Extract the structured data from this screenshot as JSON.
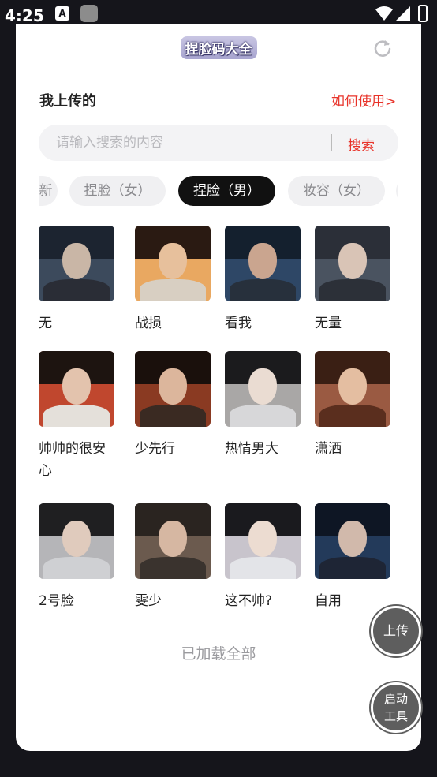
{
  "status_bar": {
    "time": "4:25",
    "a_badge": "A"
  },
  "header": {
    "title": "捏脸码大全",
    "refresh_icon": "refresh-icon"
  },
  "section": {
    "my_uploads": "我上传的",
    "how_to_use": "如何使用>"
  },
  "search": {
    "placeholder": "请输入搜索的内容",
    "button": "搜索"
  },
  "tabs": [
    {
      "label": "新",
      "active": false
    },
    {
      "label": "捏脸（女）",
      "active": false
    },
    {
      "label": "捏脸（男）",
      "active": true
    },
    {
      "label": "妆容（女）",
      "active": false
    }
  ],
  "items": [
    {
      "name": "无"
    },
    {
      "name": "战损"
    },
    {
      "name": "看我"
    },
    {
      "name": "无量"
    },
    {
      "name": "帅帅的很安心"
    },
    {
      "name": "少先行"
    },
    {
      "name": "热情男大"
    },
    {
      "name": "潇洒"
    },
    {
      "name": "2号脸"
    },
    {
      "name": "雯少"
    },
    {
      "name": "这不帅?"
    },
    {
      "name": "自用"
    }
  ],
  "footer": {
    "loaded_all": "已加载全部"
  },
  "fabs": {
    "upload": "上传",
    "launch_tool": "启动工具"
  },
  "colors": {
    "accent": "#e8332a",
    "active_tab": "#111111",
    "fab": "#5e5e5e"
  }
}
